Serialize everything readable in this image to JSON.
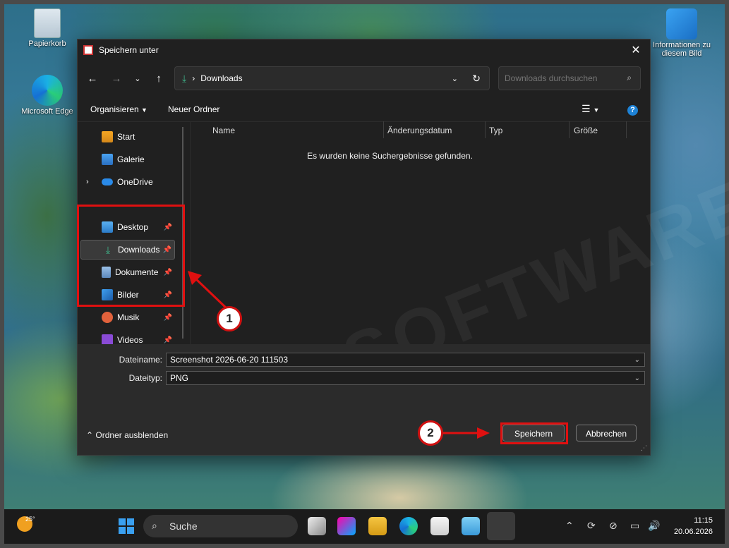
{
  "desktop": {
    "icons": [
      {
        "label": "Papierkorb",
        "icon": "recycle-bin-icon"
      },
      {
        "label": "Microsoft Edge",
        "icon": "edge-icon"
      },
      {
        "label": "Informationen zu diesem Bild",
        "icon": "image-info-icon"
      }
    ]
  },
  "dialog": {
    "title": "Speichern unter",
    "address": {
      "current": "Downloads"
    },
    "search": {
      "placeholder": "Downloads durchsuchen"
    },
    "commandbar": {
      "organize": "Organisieren",
      "new_folder": "Neuer Ordner"
    },
    "nav": [
      {
        "label": "Start",
        "pinned": false
      },
      {
        "label": "Galerie",
        "pinned": false
      },
      {
        "label": "OneDrive",
        "pinned": false
      },
      {
        "label": "Desktop",
        "pinned": true
      },
      {
        "label": "Downloads",
        "pinned": true
      },
      {
        "label": "Dokumente",
        "pinned": true
      },
      {
        "label": "Bilder",
        "pinned": true
      },
      {
        "label": "Musik",
        "pinned": true
      },
      {
        "label": "Videos",
        "pinned": true
      }
    ],
    "columns": [
      "Name",
      "Änderungsdatum",
      "Typ",
      "Größe"
    ],
    "empty_message": "Es wurden keine Suchergebnisse gefunden.",
    "filename_label": "Dateiname:",
    "filename_value": "Screenshot 2026-06-20 111503",
    "filetype_label": "Dateityp:",
    "filetype_value": "PNG",
    "hide_folders": "Ordner ausblenden",
    "save_label": "Speichern",
    "cancel_label": "Abbrechen"
  },
  "annotations": {
    "badge1": "1",
    "badge2": "2",
    "color": "#e01010"
  },
  "taskbar": {
    "weather_temp": "25°",
    "search_label": "Suche",
    "time": "11:15",
    "date": "20.06.2026"
  }
}
